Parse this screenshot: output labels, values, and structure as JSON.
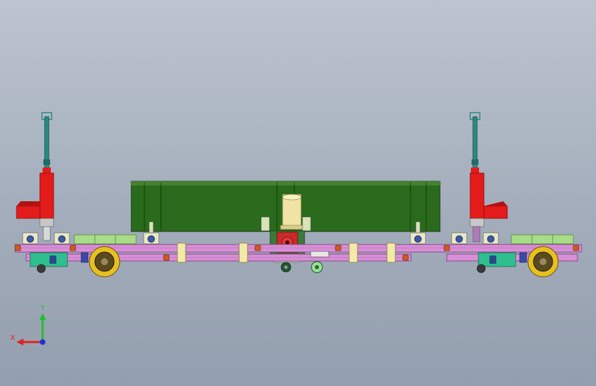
{
  "viewport": {
    "background_top": "#bcc4cf",
    "background_bottom": "#939eae"
  },
  "colors": {
    "frame_rail": "#d78fd6",
    "frame_rail_dark": "#8a4a8a",
    "container": "#2a6a1c",
    "container_light": "#4a8c34",
    "mast_red": "#e41b1b",
    "mast_teal": "#2a8a84",
    "pad_green": "#a8dc86",
    "bracket_cream": "#f2eaa8",
    "bolt_orange": "#d05a1a",
    "wheel_yellow": "#e8c020",
    "motor_cream": "#efe4a6",
    "gearbox_red": "#cc2a2a",
    "bearing_blue": "#3a5aa8",
    "caster_green": "#2fbf8f"
  },
  "triad": {
    "x_label": "X",
    "y_label": "Y",
    "x_color": "#e02020",
    "y_color": "#1fbf2f",
    "z_color": "#2030e0"
  }
}
